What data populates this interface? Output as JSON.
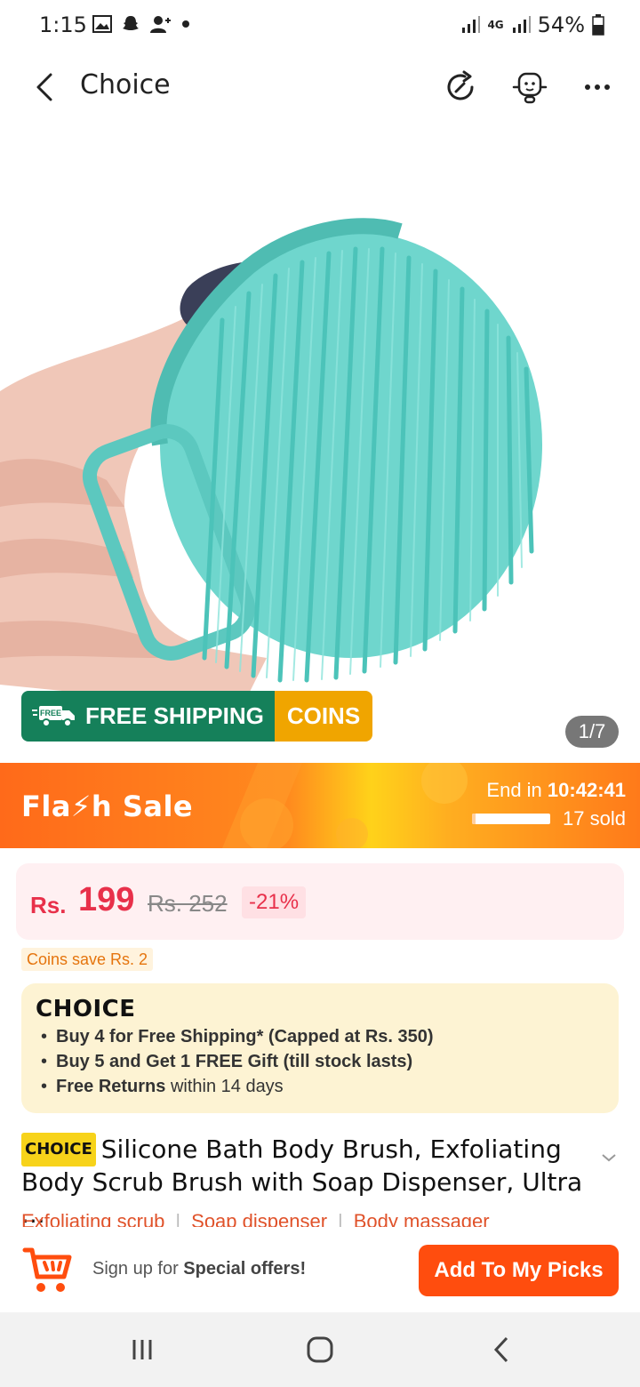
{
  "status_bar": {
    "time": "1:15",
    "network": "4G",
    "battery": "54%"
  },
  "header": {
    "title": "Choice",
    "icons": [
      "back-arrow-icon",
      "share-refresh-icon",
      "customer-service-icon",
      "more-icon"
    ]
  },
  "hero": {
    "badge_shipping": "FREE SHIPPING",
    "badge_free_small": "FREE",
    "badge_coins": "COINS",
    "image_counter": "1/7"
  },
  "flash_sale": {
    "label": "Fla⚡h Sale",
    "end_prefix": "End in",
    "end_time": "10:42:41",
    "sold": "17 sold",
    "progress": 0.05
  },
  "price": {
    "currency": "Rs.",
    "value": "199",
    "original": "Rs. 252",
    "discount": "-21%",
    "coins_save": "Coins save Rs. 2"
  },
  "choice_box": {
    "logo": "CHOICE",
    "benefits": [
      "Buy 4 for  Free Shipping* (Capped at Rs. 350)",
      "Buy 5 and Get 1 FREE Gift (till stock lasts)"
    ],
    "returns_bold": "Free Returns",
    "returns_rest": " within 14 days"
  },
  "product": {
    "tag": "CHOICE",
    "title": "Silicone Bath Body Brush, Exfoliating Body Scrub Brush with Soap Dispenser, Ultra ...",
    "tags": [
      "Exfoliating scrub",
      "Soap dispenser",
      "Body massager"
    ]
  },
  "action_bar": {
    "signup_prefix": "Sign up for ",
    "signup_bold": "Special offers!",
    "button": "Add To My Picks"
  },
  "colors": {
    "accent": "#ff4d0e",
    "price_red": "#e8304a",
    "shipping_green": "#15805a",
    "coins_orange": "#f0a500",
    "choice_yellow": "#f7d31a"
  }
}
